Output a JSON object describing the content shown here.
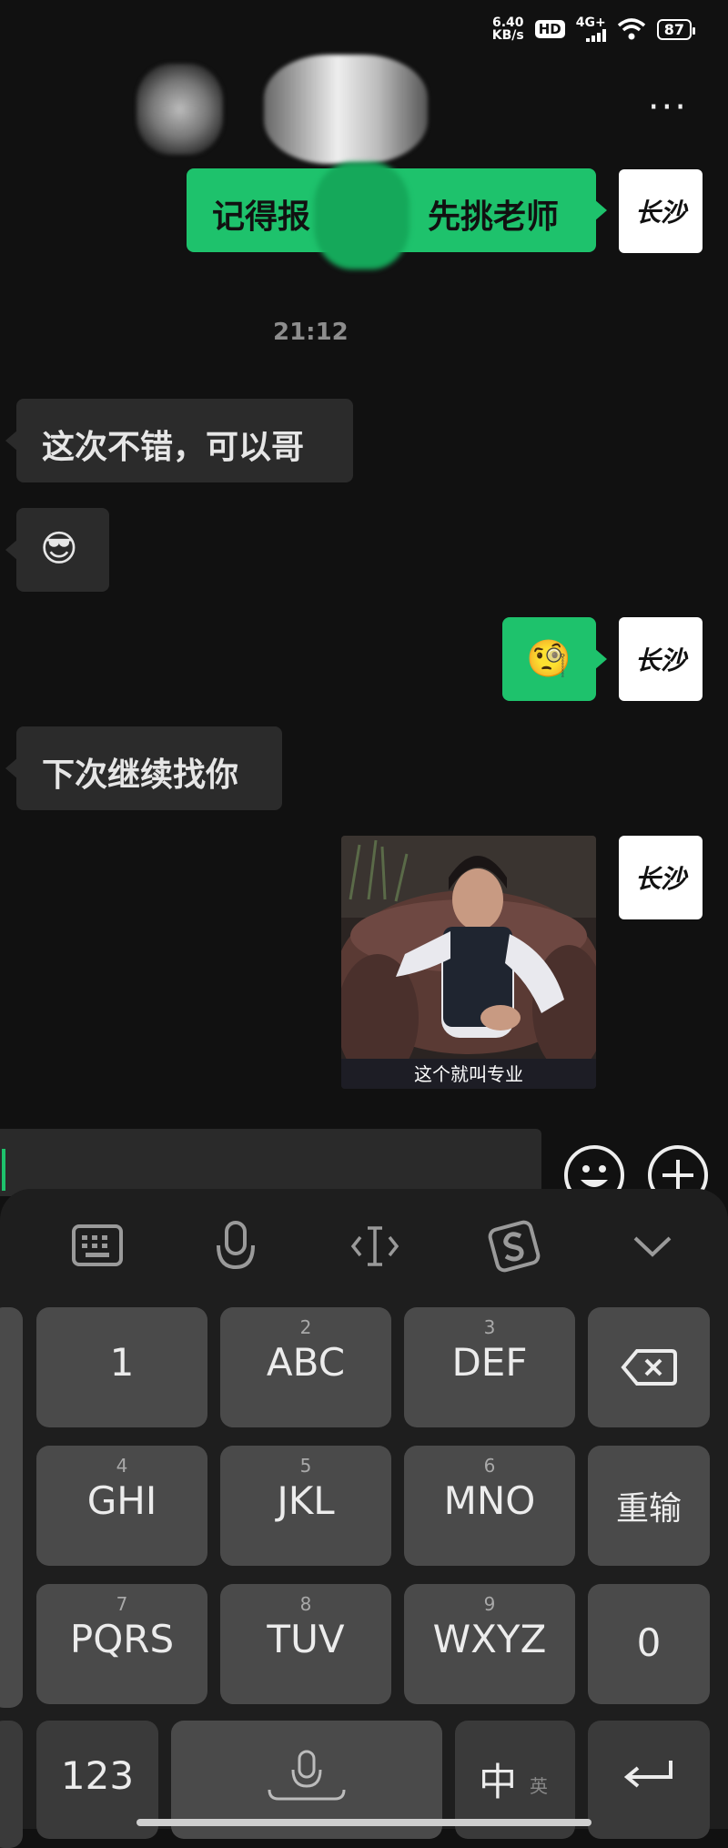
{
  "status_bar": {
    "speed_value": "6.40",
    "speed_unit": "KB/s",
    "hd": "HD",
    "network": "4G+",
    "battery": "87"
  },
  "header": {
    "more": "···"
  },
  "avatar_text": "长沙",
  "messages": {
    "out1_part1": "记得报",
    "out1_part2": "先挑老师",
    "time": "21:12",
    "in1": "这次不错，可以哥",
    "in2_emoji": "😎",
    "out2_emoji": "🧐",
    "in3": "下次继续找你",
    "image_caption": "这个就叫专业"
  },
  "keyboard": {
    "keys": [
      {
        "num": "",
        "label": "1"
      },
      {
        "num": "2",
        "label": "ABC"
      },
      {
        "num": "3",
        "label": "DEF"
      },
      {
        "num": "4",
        "label": "GHI"
      },
      {
        "num": "5",
        "label": "JKL"
      },
      {
        "num": "6",
        "label": "MNO"
      },
      {
        "num": "7",
        "label": "PQRS"
      },
      {
        "num": "8",
        "label": "TUV"
      },
      {
        "num": "9",
        "label": "WXYZ"
      }
    ],
    "reset": "重输",
    "zero": "0",
    "num_mode": "123",
    "lang": "中",
    "lang_alt": "英"
  }
}
